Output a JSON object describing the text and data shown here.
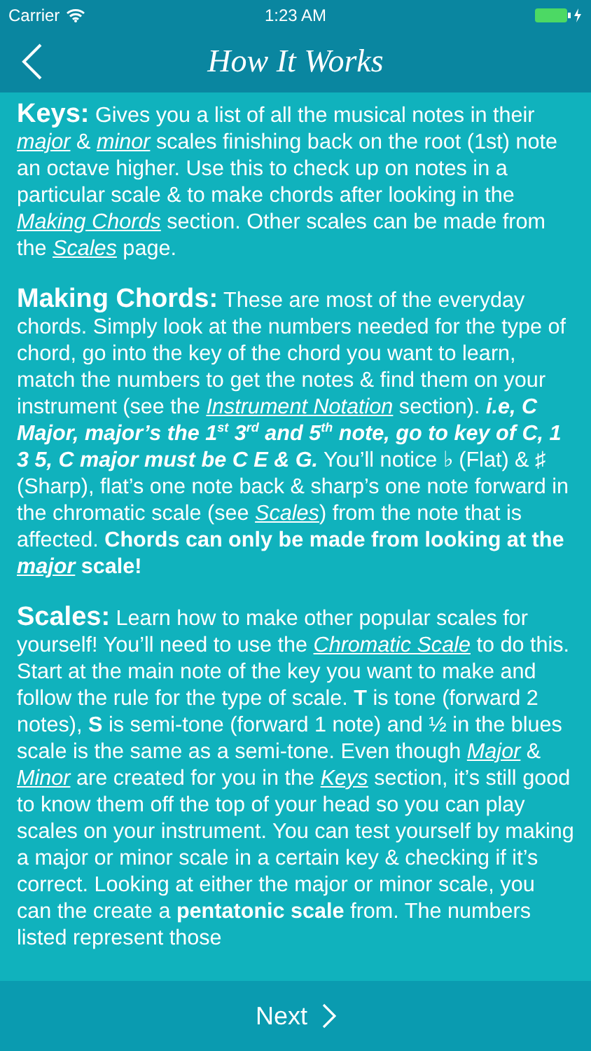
{
  "status_bar": {
    "carrier": "Carrier",
    "time": "1:23 AM",
    "charging": true
  },
  "nav_bar": {
    "title": "How It Works"
  },
  "sections": [
    {
      "heading": "Keys:",
      "body": "Gives you a list of all the musical notes in their *major* & *minor* scales finishing back on the root (1st) note an octave higher. Use this to check up on notes in a particular scale & to make chords after looking in the *Making Chords* section. Other scales can be made from the *Scales* page."
    },
    {
      "heading": "Making Chords:",
      "body": "These are most of the everyday chords. Simply look at the numbers needed for the type of chord, go into the key of the chord you want to learn, match the numbers to get the notes & find them on your instrument (see the *Instrument Notation* section).",
      "emphasis": "i.e, C Major, major’s the 1$^{st}$ 3$^{rd}$ and 5$^{th}$ note, go to key of C, 1 3 5, C major must be C E & G.",
      "body_after": "You’ll notice ♭ (Flat) & ♯ (Sharp), flat’s one note back & sharp’s one note forward in the chromatic scale (see *Scales*) from the note that is affected. **Chords can only be made from looking at the *major* scale!**"
    },
    {
      "heading": "Scales:",
      "body": "Learn how to make other popular scales for yourself! You’ll need to use the *Chromatic Scale* to do this. Start at the main note of the key you want to make and follow the rule for the type of scale. **T** is tone (forward 2 notes), **S** is semi-tone (forward 1 note) and ½ in the blues scale is the same as a semi-tone. Even though *Major* & *Minor* are created for you in the *Keys* section, it’s still good to know them off the top of your head so you can play scales on your instrument. You can test yourself by making a major or minor scale in a certain key & checking if it’s correct. Looking at either the major or minor scale, you can the create a **pentatonic scale** from. The numbers listed represent those"
    }
  ],
  "footer": {
    "next_label": "Next"
  }
}
